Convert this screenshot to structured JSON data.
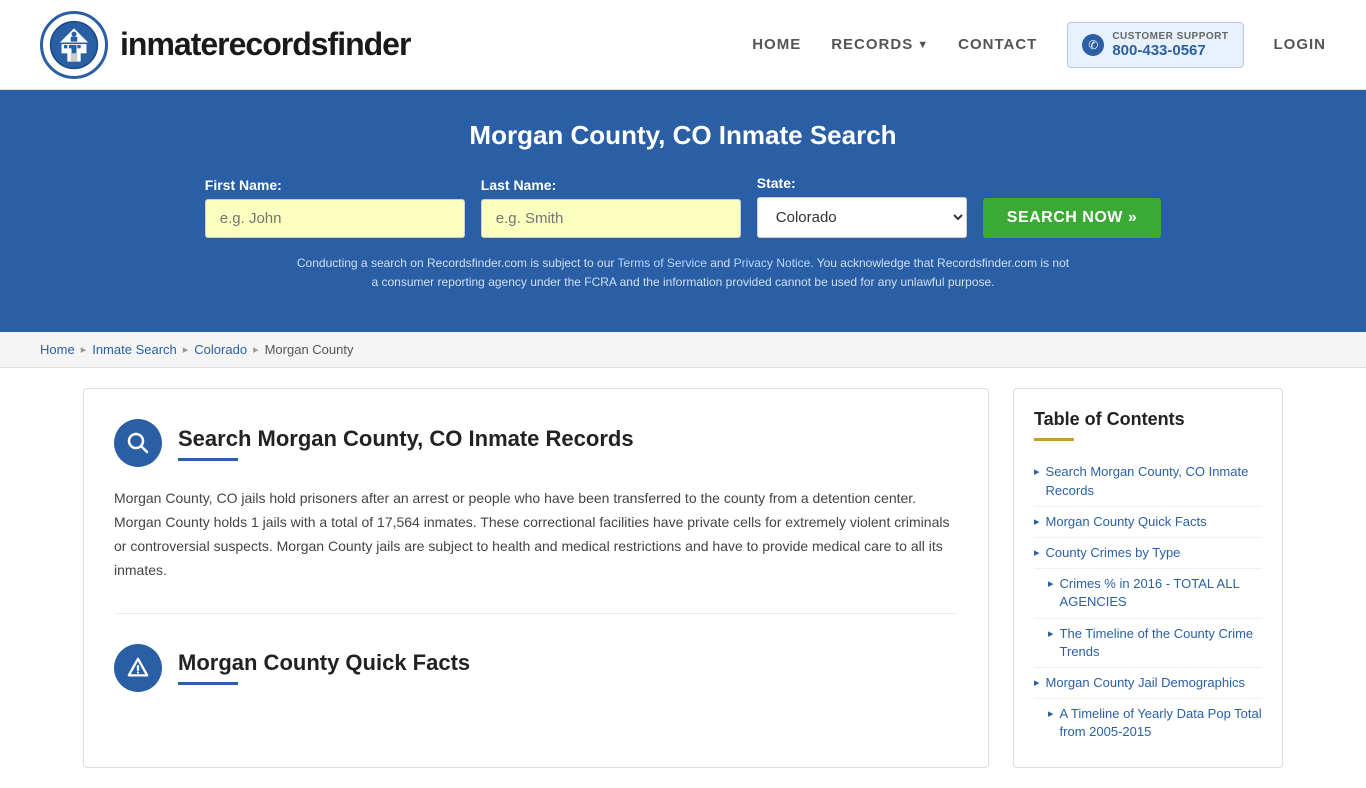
{
  "header": {
    "logo_text_light": "inmaterecords",
    "logo_text_bold": "finder",
    "nav": {
      "home": "HOME",
      "records": "RECORDS",
      "contact": "CONTACT",
      "login": "LOGIN"
    },
    "customer_support": {
      "label": "CUSTOMER SUPPORT",
      "phone": "800-433-0567"
    }
  },
  "hero": {
    "title": "Morgan County, CO Inmate Search",
    "form": {
      "first_name_label": "First Name:",
      "first_name_placeholder": "e.g. John",
      "last_name_label": "Last Name:",
      "last_name_placeholder": "e.g. Smith",
      "state_label": "State:",
      "state_value": "Colorado",
      "search_button": "SEARCH NOW »"
    },
    "disclaimer": "Conducting a search on Recordsfinder.com is subject to our Terms of Service and Privacy Notice. You acknowledge that Recordsfinder.com is not a consumer reporting agency under the FCRA and the information provided cannot be used for any unlawful purpose."
  },
  "breadcrumb": {
    "items": [
      "Home",
      "Inmate Search",
      "Colorado",
      "Morgan County"
    ]
  },
  "main_section": {
    "icon": "🔍",
    "title": "Search Morgan County, CO Inmate Records",
    "body": "Morgan County, CO jails hold prisoners after an arrest or people who have been transferred to the county from a detention center. Morgan County holds 1 jails with a total of 17,564 inmates. These correctional facilities have private cells for extremely violent criminals or controversial suspects. Morgan County jails are subject to health and medical restrictions and have to provide medical care to all its inmates."
  },
  "second_section": {
    "icon": "⚠",
    "title": "Morgan County Quick Facts"
  },
  "toc": {
    "title": "Table of Contents",
    "items": [
      {
        "label": "Search Morgan County, CO Inmate Records",
        "indent": false
      },
      {
        "label": "Morgan County Quick Facts",
        "indent": false
      },
      {
        "label": "County Crimes by Type",
        "indent": false
      },
      {
        "label": "Crimes % in 2016 - TOTAL ALL AGENCIES",
        "indent": true
      },
      {
        "label": "The Timeline of the County Crime Trends",
        "indent": true
      },
      {
        "label": "Morgan County Jail Demographics",
        "indent": false
      },
      {
        "label": "A Timeline of Yearly Data Pop Total from 2005-2015",
        "indent": true
      }
    ]
  }
}
